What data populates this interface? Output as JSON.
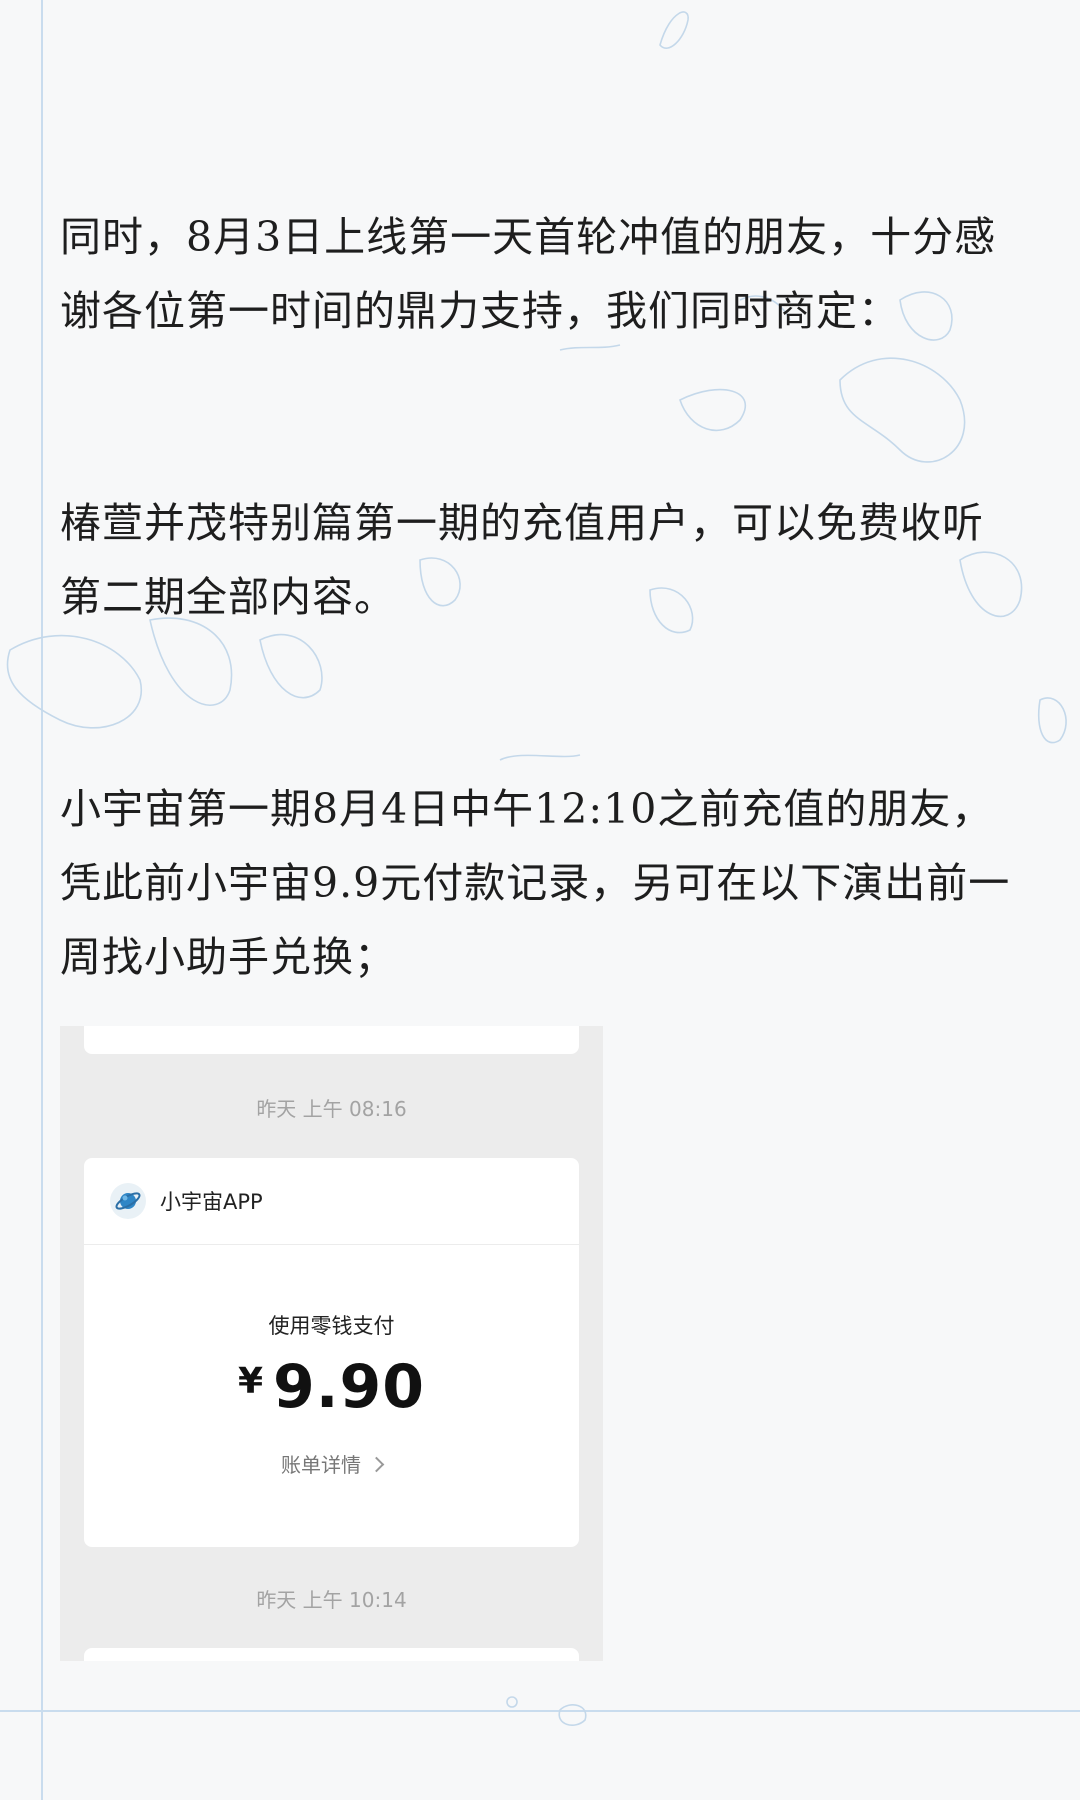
{
  "article": {
    "paragraphs": [
      "同时，8月3日上线第一天首轮冲值的朋友，十分感谢各位第一时间的鼎力支持，我们同时商定：",
      "椿萱并茂特别篇第一期的充值用户，可以免费收听第二期全部内容。",
      "小宇宙第一期8月4日中午12:10之前充值的朋友，凭此前小宇宙9.9元付款记录，另可在以下演出前一周找小助手兑换；"
    ]
  },
  "screenshot": {
    "time_top": "昨天 上午 08:16",
    "app_name": "小宇宙APP",
    "app_icon": "planet-icon",
    "pay_label": "使用零钱支付",
    "currency": "¥",
    "amount": "9.90",
    "bill_link": "账单详情",
    "time_bottom": "昨天 上午 10:14"
  },
  "colors": {
    "background": "#f7f8f9",
    "text": "#1e1e1e",
    "line_accent": "#bfd6ea",
    "screenshot_bg": "#ececec"
  }
}
